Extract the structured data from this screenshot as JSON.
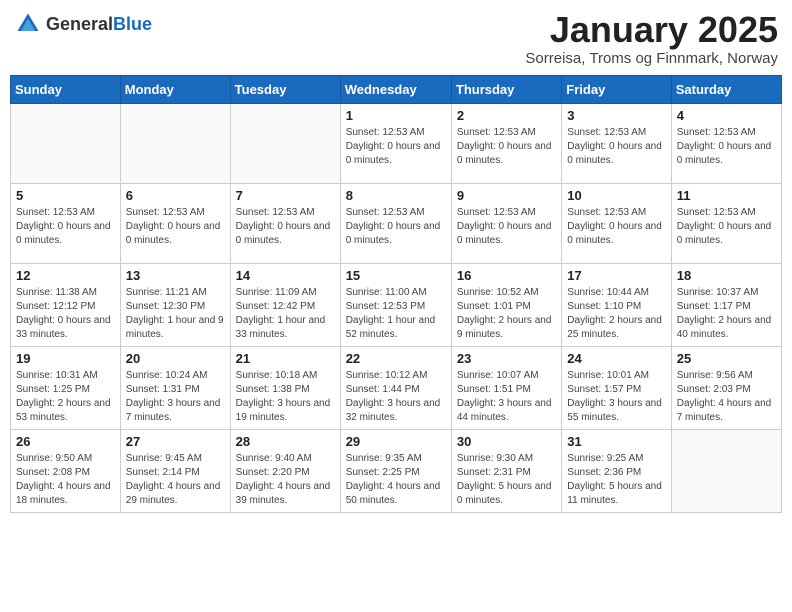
{
  "header": {
    "logo_general": "General",
    "logo_blue": "Blue",
    "month_title": "January 2025",
    "subtitle": "Sorreisa, Troms og Finnmark, Norway"
  },
  "columns": [
    "Sunday",
    "Monday",
    "Tuesday",
    "Wednesday",
    "Thursday",
    "Friday",
    "Saturday"
  ],
  "weeks": [
    [
      {
        "day": "",
        "info": ""
      },
      {
        "day": "",
        "info": ""
      },
      {
        "day": "",
        "info": ""
      },
      {
        "day": "1",
        "info": "Sunset: 12:53 AM\nDaylight: 0 hours and 0 minutes."
      },
      {
        "day": "2",
        "info": "Sunset: 12:53 AM\nDaylight: 0 hours and 0 minutes."
      },
      {
        "day": "3",
        "info": "Sunset: 12:53 AM\nDaylight: 0 hours and 0 minutes."
      },
      {
        "day": "4",
        "info": "Sunset: 12:53 AM\nDaylight: 0 hours and 0 minutes."
      }
    ],
    [
      {
        "day": "5",
        "info": "Sunset: 12:53 AM\nDaylight: 0 hours and 0 minutes."
      },
      {
        "day": "6",
        "info": "Sunset: 12:53 AM\nDaylight: 0 hours and 0 minutes."
      },
      {
        "day": "7",
        "info": "Sunset: 12:53 AM\nDaylight: 0 hours and 0 minutes."
      },
      {
        "day": "8",
        "info": "Sunset: 12:53 AM\nDaylight: 0 hours and 0 minutes."
      },
      {
        "day": "9",
        "info": "Sunset: 12:53 AM\nDaylight: 0 hours and 0 minutes."
      },
      {
        "day": "10",
        "info": "Sunset: 12:53 AM\nDaylight: 0 hours and 0 minutes."
      },
      {
        "day": "11",
        "info": "Sunset: 12:53 AM\nDaylight: 0 hours and 0 minutes."
      }
    ],
    [
      {
        "day": "12",
        "info": "Sunrise: 11:38 AM\nSunset: 12:12 PM\nDaylight: 0 hours and 33 minutes."
      },
      {
        "day": "13",
        "info": "Sunrise: 11:21 AM\nSunset: 12:30 PM\nDaylight: 1 hour and 9 minutes."
      },
      {
        "day": "14",
        "info": "Sunrise: 11:09 AM\nSunset: 12:42 PM\nDaylight: 1 hour and 33 minutes."
      },
      {
        "day": "15",
        "info": "Sunrise: 11:00 AM\nSunset: 12:53 PM\nDaylight: 1 hour and 52 minutes."
      },
      {
        "day": "16",
        "info": "Sunrise: 10:52 AM\nSunset: 1:01 PM\nDaylight: 2 hours and 9 minutes."
      },
      {
        "day": "17",
        "info": "Sunrise: 10:44 AM\nSunset: 1:10 PM\nDaylight: 2 hours and 25 minutes."
      },
      {
        "day": "18",
        "info": "Sunrise: 10:37 AM\nSunset: 1:17 PM\nDaylight: 2 hours and 40 minutes."
      }
    ],
    [
      {
        "day": "19",
        "info": "Sunrise: 10:31 AM\nSunset: 1:25 PM\nDaylight: 2 hours and 53 minutes."
      },
      {
        "day": "20",
        "info": "Sunrise: 10:24 AM\nSunset: 1:31 PM\nDaylight: 3 hours and 7 minutes."
      },
      {
        "day": "21",
        "info": "Sunrise: 10:18 AM\nSunset: 1:38 PM\nDaylight: 3 hours and 19 minutes."
      },
      {
        "day": "22",
        "info": "Sunrise: 10:12 AM\nSunset: 1:44 PM\nDaylight: 3 hours and 32 minutes."
      },
      {
        "day": "23",
        "info": "Sunrise: 10:07 AM\nSunset: 1:51 PM\nDaylight: 3 hours and 44 minutes."
      },
      {
        "day": "24",
        "info": "Sunrise: 10:01 AM\nSunset: 1:57 PM\nDaylight: 3 hours and 55 minutes."
      },
      {
        "day": "25",
        "info": "Sunrise: 9:56 AM\nSunset: 2:03 PM\nDaylight: 4 hours and 7 minutes."
      }
    ],
    [
      {
        "day": "26",
        "info": "Sunrise: 9:50 AM\nSunset: 2:08 PM\nDaylight: 4 hours and 18 minutes."
      },
      {
        "day": "27",
        "info": "Sunrise: 9:45 AM\nSunset: 2:14 PM\nDaylight: 4 hours and 29 minutes."
      },
      {
        "day": "28",
        "info": "Sunrise: 9:40 AM\nSunset: 2:20 PM\nDaylight: 4 hours and 39 minutes."
      },
      {
        "day": "29",
        "info": "Sunrise: 9:35 AM\nSunset: 2:25 PM\nDaylight: 4 hours and 50 minutes."
      },
      {
        "day": "30",
        "info": "Sunrise: 9:30 AM\nSunset: 2:31 PM\nDaylight: 5 hours and 0 minutes."
      },
      {
        "day": "31",
        "info": "Sunrise: 9:25 AM\nSunset: 2:36 PM\nDaylight: 5 hours and 11 minutes."
      },
      {
        "day": "",
        "info": ""
      }
    ]
  ]
}
